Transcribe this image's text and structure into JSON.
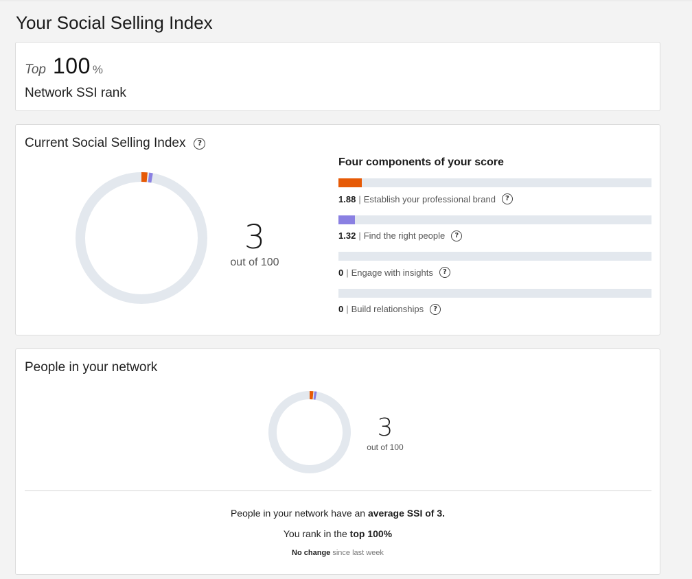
{
  "page": {
    "title": "Your Social Selling Index"
  },
  "rank_card": {
    "prefix": "Top",
    "value": "100",
    "unit": "%",
    "label": "Network SSI rank"
  },
  "index_card": {
    "title": "Current Social Selling Index",
    "score": "3",
    "score_suffix": "out of 100",
    "components_title": "Four components of your score",
    "components": [
      {
        "value": "1.88",
        "label": "Establish your professional brand",
        "max": 25,
        "color": "#e65a06"
      },
      {
        "value": "1.32",
        "label": "Find the right people",
        "max": 25,
        "color": "#8a80e2"
      },
      {
        "value": "0",
        "label": "Engage with insights",
        "max": 25,
        "color": "#2aa3a1"
      },
      {
        "value": "0",
        "label": "Build relationships",
        "max": 25,
        "color": "#3c9cd8"
      }
    ],
    "separator": "|"
  },
  "network_card": {
    "title": "People in your network",
    "score": "3",
    "score_suffix": "out of 100",
    "avg_text_pre": "People in your network have an",
    "avg_text_bold": "average SSI of 3.",
    "rank_text_pre": "You rank in the",
    "rank_text_bold": "top 100%",
    "change_bold": "No change",
    "change_rest": "since last week"
  },
  "colors": {
    "track": "#e3e8ee",
    "brand": "#e65a06",
    "people": "#8a80e2"
  }
}
